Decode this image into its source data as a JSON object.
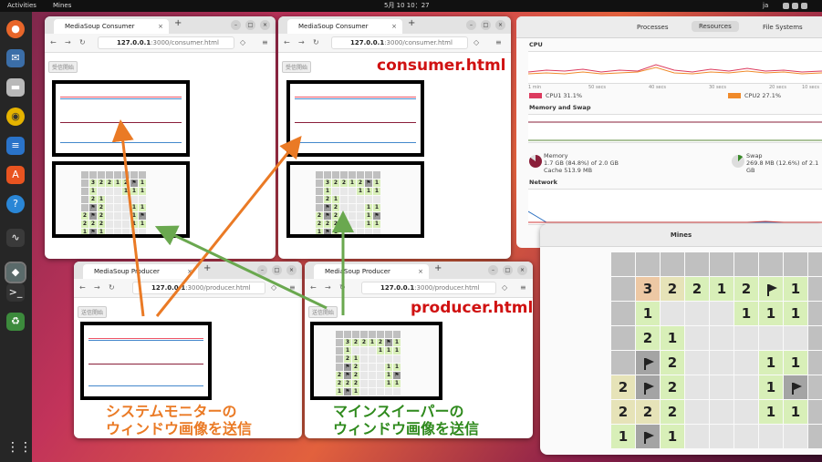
{
  "topbar": {
    "activities": "Activities",
    "app_name": "Mines",
    "clock": "5月 10 10：27",
    "lang": "ja"
  },
  "consumer_left": {
    "tab": "MediaSoup Consumer",
    "url_host": "127.0.0.1",
    "url_rest": ":3000/consumer.html",
    "button": "受信開始"
  },
  "consumer_right": {
    "tab": "MediaSoup Consumer",
    "url_host": "127.0.0.1",
    "url_rest": ":3000/consumer.html",
    "button": "受信開始"
  },
  "producer_left": {
    "tab": "MediaSoup Producer",
    "url_host": "127.0.0.1",
    "url_rest": ":3000/producer.html",
    "button": "送信開始"
  },
  "producer_right": {
    "tab": "MediaSoup Producer",
    "url_host": "127.0.0.1",
    "url_rest": ":3000/producer.html",
    "button": "送信開始"
  },
  "labels": {
    "consumer": "consumer.html",
    "producer": "producer.html",
    "sysmon_send_1": "システムモニターの",
    "sysmon_send_2": "ウィンドウ画像を送信",
    "mines_send_1": "マインスイーパーの",
    "mines_send_2": "ウィンドウ画像を送信"
  },
  "sysmon": {
    "tabs": [
      "Processes",
      "Resources",
      "File Systems"
    ],
    "active_tab": "Resources",
    "cpu_title": "CPU",
    "cpu_ticks": [
      "1 min",
      "50 secs",
      "40 secs",
      "30 secs",
      "20 secs",
      "10 secs"
    ],
    "cpu1": "CPU1   31.1%",
    "cpu2": "CPU2   27.1%",
    "cpu1_color": "#dc3a5e",
    "cpu2_color": "#f08a2a",
    "mem_title": "Memory and Swap",
    "mem_label": "Memory",
    "mem_value": "1.7 GB (84.8%) of 2.0 GB",
    "cache": "Cache 513.9 MB",
    "swap_label": "Swap",
    "swap_value": "269.8 MB (12.6%) of 2.1 GB",
    "net_title": "Network"
  },
  "mines": {
    "title": "Mines",
    "board": [
      [
        "c",
        "c",
        "c",
        "c",
        "c",
        "c",
        "c",
        "c",
        "c"
      ],
      [
        "c",
        "3p",
        "2y",
        "2o",
        "1o",
        "2o",
        "Fo",
        "1o",
        "c"
      ],
      [
        "c",
        "1o",
        "w",
        "w",
        "w",
        "1o",
        "1o",
        "1o",
        "c"
      ],
      [
        "c",
        "2o",
        "1o",
        "w",
        "w",
        "w",
        "w",
        "w",
        "c"
      ],
      [
        "c",
        "F",
        "2o",
        "w",
        "w",
        "w",
        "1o",
        "1o",
        "c"
      ],
      [
        "2y",
        "F",
        "2o",
        "w",
        "w",
        "w",
        "1o",
        "F",
        "c"
      ],
      [
        "2y",
        "2y",
        "2o",
        "w",
        "w",
        "w",
        "1o",
        "1o",
        "c"
      ],
      [
        "1o",
        "F",
        "1o",
        "w",
        "w",
        "w",
        "w",
        "w",
        "c"
      ]
    ]
  },
  "mini_board": [
    [
      "c",
      "c",
      "c",
      "c",
      "c",
      "c",
      "c",
      "c"
    ],
    [
      "c",
      "3",
      "2",
      "2",
      "1",
      "2",
      "F",
      "1"
    ],
    [
      "c",
      "1",
      "w",
      "w",
      "w",
      "1",
      "1",
      "1"
    ],
    [
      "c",
      "2",
      "1",
      "w",
      "w",
      "w",
      "w",
      "w"
    ],
    [
      "c",
      "F",
      "2",
      "w",
      "w",
      "w",
      "1",
      "1"
    ],
    [
      "2",
      "F",
      "2",
      "w",
      "w",
      "w",
      "1",
      "F"
    ],
    [
      "2",
      "2",
      "2",
      "w",
      "w",
      "w",
      "1",
      "1"
    ],
    [
      "1",
      "F",
      "1",
      "w",
      "w",
      "w",
      "w",
      "w"
    ]
  ]
}
